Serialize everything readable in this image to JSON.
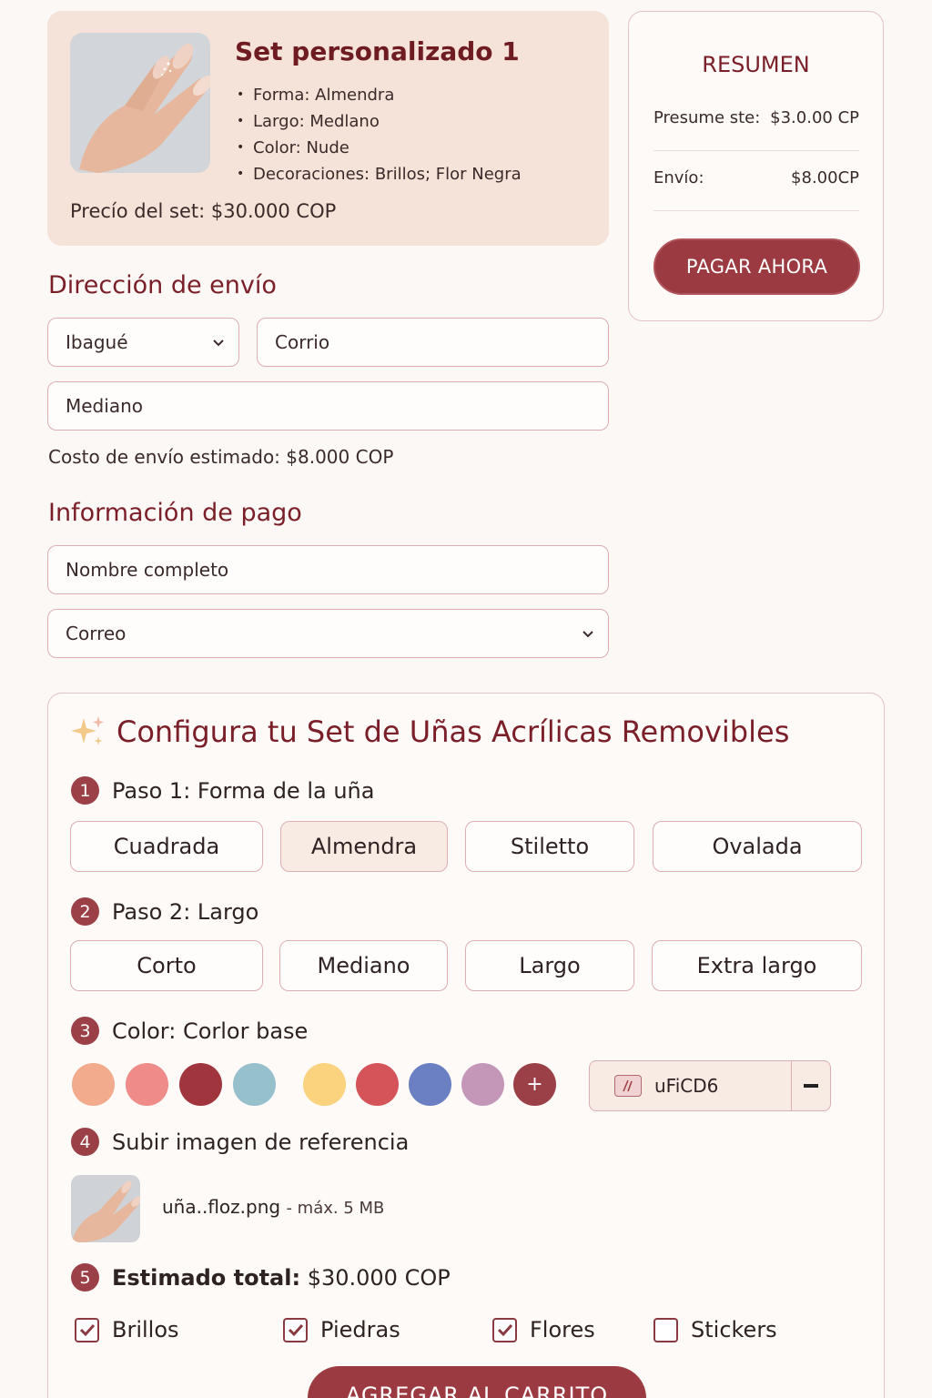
{
  "product": {
    "title": "Set personalizado 1",
    "specs": [
      "Forma: Almendra",
      "Largo: Medlano",
      "Color: Nude",
      "Decoraciones: Brillos; Flor Negra"
    ],
    "price": "Precío del set: $30.000 COP"
  },
  "summary": {
    "title": "RESUMEN",
    "subtotal_label": "Presume ste:",
    "subtotal_value": "$3.0.00 CP",
    "shipping_label": "Envío:",
    "shipping_value": "$8.00CP",
    "pay_label": "PAGAR AHORA"
  },
  "shipping": {
    "heading": "Dirección de envío",
    "city_value": "Ibagué",
    "street_value": "Corrio",
    "size_value": "Mediano",
    "cost_text": "Costo de envío estimado:  $8.000 COP"
  },
  "payment": {
    "heading": "Información de pago",
    "name_placeholder": "Nombre completo",
    "email_value": "Correo"
  },
  "config": {
    "title": "Configura tu Set de Uñas Acrílicas Removibles",
    "sparkle_icon": "sparkle-icon",
    "step1": {
      "num": "1",
      "label": "Paso 1: Forma de la uña",
      "options": [
        "Cuadrada",
        "Almendra",
        "Stiletto",
        "Ovalada"
      ],
      "selected": "Almendra"
    },
    "step2": {
      "num": "2",
      "label": "Paso 2: Largo",
      "options": [
        "Corto",
        "Mediano",
        "Largo",
        "Extra largo"
      ]
    },
    "step3": {
      "num": "3",
      "label": "Color: Corlor base",
      "swatches": [
        "#f2ab8c",
        "#ef8b88",
        "#a0353d",
        "#97c0cd",
        "#fbd37f",
        "#d45459",
        "#6b7fc3",
        "#c497b8"
      ],
      "add_label": "+",
      "hex_value": "uFiCD6"
    },
    "step4": {
      "num": "4",
      "label": "Subir imagen de referencia",
      "file_name": "uña..floz.png",
      "file_limit": "- máx. 5 MB"
    },
    "step5": {
      "num": "5",
      "label_bold": "Estimado total:",
      "label_value": " $30.000 COP"
    },
    "checks": [
      {
        "label": "Brillos",
        "checked": true
      },
      {
        "label": "Piedras",
        "checked": true
      },
      {
        "label": "Flores",
        "checked": true
      },
      {
        "label": "Stickers",
        "checked": false
      }
    ],
    "cart_label": "AGREGAR AL CARRITO"
  },
  "colors": {
    "accent": "#9c3a42",
    "heading": "#7a1f28",
    "card_bg": "#f5e2d8",
    "border": "#dcaeb2"
  }
}
